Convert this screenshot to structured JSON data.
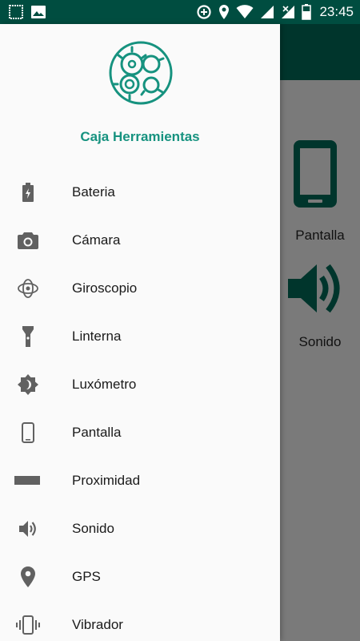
{
  "status_bar": {
    "time": "23:45",
    "icons": [
      "image-icon",
      "sim-icon",
      "data-saver-icon",
      "location-icon",
      "wifi-icon",
      "signal-icon",
      "signal-no-data-icon",
      "battery-icon"
    ]
  },
  "background_app": {
    "cards": [
      {
        "label": "Pantalla",
        "icon": "phone-icon"
      },
      {
        "label": "Sonido",
        "icon": "speaker-icon"
      }
    ]
  },
  "drawer": {
    "title": "Caja Herramientas",
    "logo": "gears-logo",
    "items": [
      {
        "label": "Bateria",
        "icon": "battery-charging-icon"
      },
      {
        "label": "Cámara",
        "icon": "camera-icon"
      },
      {
        "label": "Giroscopio",
        "icon": "gyroscope-icon"
      },
      {
        "label": "Linterna",
        "icon": "flashlight-icon"
      },
      {
        "label": "Luxómetro",
        "icon": "brightness-icon"
      },
      {
        "label": "Pantalla",
        "icon": "phone-icon"
      },
      {
        "label": "Proximidad",
        "icon": "proximity-bar-icon"
      },
      {
        "label": "Sonido",
        "icon": "volume-icon"
      },
      {
        "label": "GPS",
        "icon": "location-pin-icon"
      },
      {
        "label": "Vibrador",
        "icon": "vibration-icon"
      }
    ]
  },
  "colors": {
    "status_bar": "#004d40",
    "toolbar": "#00352c",
    "accent": "#16927f",
    "icon_gray": "#616161",
    "scrim": "#7a7a7a"
  }
}
